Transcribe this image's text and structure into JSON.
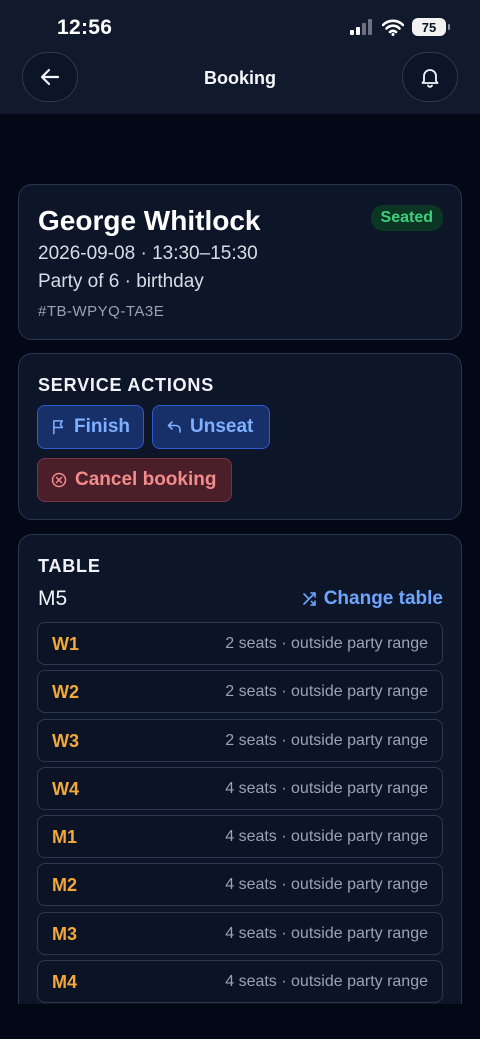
{
  "status_bar": {
    "time": "12:56",
    "battery": "75"
  },
  "nav": {
    "title": "Booking"
  },
  "booking": {
    "guest_name": "George Whitlock",
    "status": "Seated",
    "datetime": "2026-09-08 · 13:30–15:30",
    "party": "Party of 6 · birthday",
    "reference": "#TB-WPYQ-TA3E"
  },
  "service_actions": {
    "title": "SERVICE ACTIONS",
    "finish_label": "Finish",
    "unseat_label": "Unseat",
    "cancel_label": "Cancel booking"
  },
  "table": {
    "title": "TABLE",
    "current": "M5",
    "change_label": "Change table",
    "options": [
      {
        "code": "W1",
        "info": "2 seats · outside party range"
      },
      {
        "code": "W2",
        "info": "2 seats · outside party range"
      },
      {
        "code": "W3",
        "info": "2 seats · outside party range"
      },
      {
        "code": "W4",
        "info": "4 seats · outside party range"
      },
      {
        "code": "M1",
        "info": "4 seats · outside party range"
      },
      {
        "code": "M2",
        "info": "4 seats · outside party range"
      },
      {
        "code": "M3",
        "info": "4 seats · outside party range"
      },
      {
        "code": "M4",
        "info": "4 seats · outside party range"
      }
    ]
  },
  "colors": {
    "background": "#030816",
    "card": "#0d1628",
    "accent_blue": "#6ea5ff",
    "table_code": "#f2a93a",
    "status_green": "#3ed07e",
    "danger": "#f38b8b"
  },
  "icons": {
    "back": "arrow-left-icon",
    "bell": "bell-icon",
    "finish": "flag-icon",
    "unseat": "undo-icon",
    "cancel": "circle-x-icon",
    "change_table": "shuffle-icon"
  }
}
